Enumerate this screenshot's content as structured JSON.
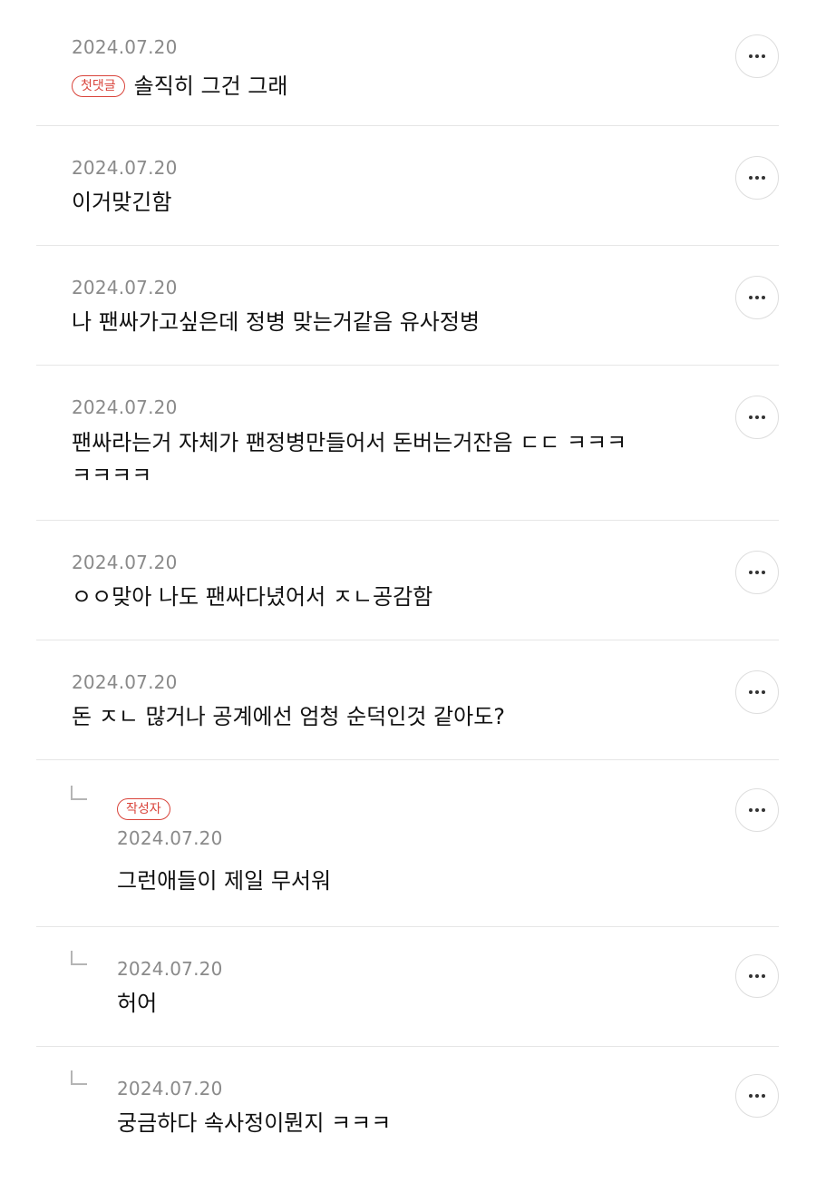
{
  "comments": [
    {
      "date": "2024.07.20",
      "badge": "첫댓글",
      "text": "솔직히 그건 그래"
    },
    {
      "date": "2024.07.20",
      "text": "이거맞긴함"
    },
    {
      "date": "2024.07.20",
      "text": "나 팬싸가고싶은데 정병 맞는거같음 유사정병"
    },
    {
      "date": "2024.07.20",
      "text_line1": "팬싸라는거 자체가 팬정병만들어서 돈버는거잔음 ㄷㄷ ㅋㅋㅋ",
      "text_line2": "ㅋㅋㅋㅋ"
    },
    {
      "date": "2024.07.20",
      "text": "ㅇㅇ맞아 나도 팬싸다녔어서 ㅈㄴ공감함"
    },
    {
      "date": "2024.07.20",
      "text": "돈 ㅈㄴ 많거나 공계에선 엄청 순덕인것 같아도?"
    }
  ],
  "replies": [
    {
      "badge": "작성자",
      "date": "2024.07.20",
      "text": "그런애들이 제일 무서워"
    },
    {
      "date": "2024.07.20",
      "text": "허어"
    },
    {
      "date": "2024.07.20",
      "text": "궁금하다 속사정이뭔지 ㅋㅋㅋ"
    }
  ],
  "icons": {
    "more": "more-options-icon",
    "reply": "reply-arrow-icon"
  },
  "colors": {
    "badge": "#d9443b",
    "date": "#8a8a8a",
    "divider": "#e6e6e6"
  }
}
